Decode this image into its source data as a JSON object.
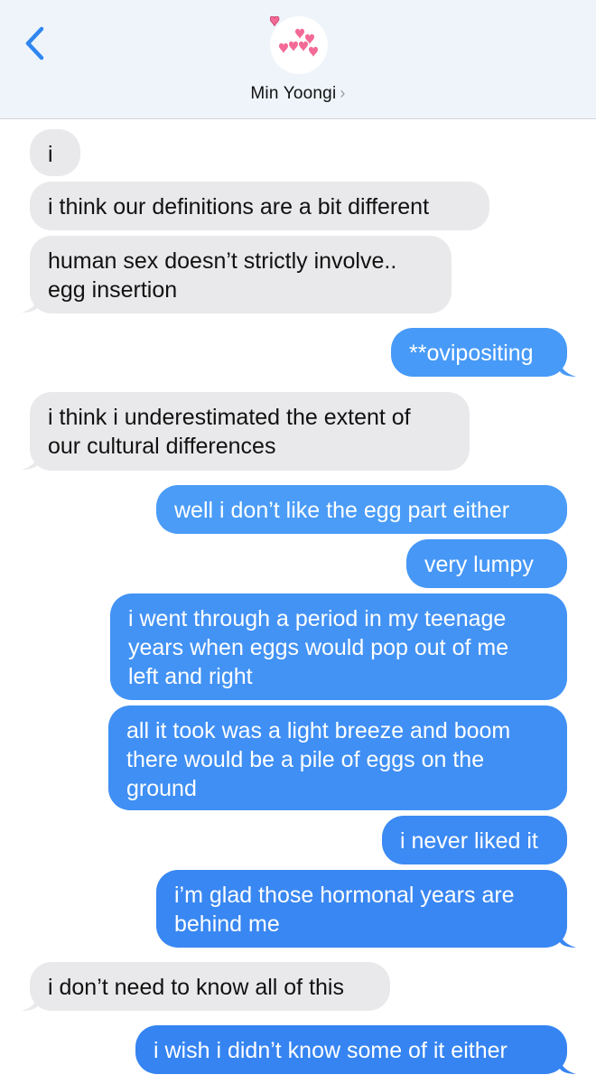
{
  "header": {
    "contact_name": "Min Yoongi",
    "chevron": "›",
    "back_icon": "chevron-left-icon",
    "avatar_icon": "hearts-avatar-icon"
  },
  "colors": {
    "header_bg": "#eef4fa",
    "received_bubble": "#e9e9eb",
    "sent_bubble": "#3e8ef5",
    "accent": "#2f86f0"
  },
  "messages": [
    {
      "from": "received",
      "text": "i"
    },
    {
      "from": "received",
      "text": "i think our definitions are a bit different"
    },
    {
      "from": "received",
      "text": "human sex doesn’t strictly involve..\negg insertion"
    },
    {
      "from": "sent",
      "text": "**ovipositing"
    },
    {
      "from": "received",
      "text": "i think i underestimated the extent of\nour cultural differences"
    },
    {
      "from": "sent",
      "text": "well i don’t like the egg part either"
    },
    {
      "from": "sent",
      "text": "very lumpy"
    },
    {
      "from": "sent",
      "text": "i went through a period in my teenage\nyears when eggs would pop out of me\nleft and right"
    },
    {
      "from": "sent",
      "text": "all it took was a light breeze and boom\nthere would be a pile of eggs on the\nground"
    },
    {
      "from": "sent",
      "text": "i never liked it"
    },
    {
      "from": "sent",
      "text": "i’m glad those hormonal years are\nbehind me"
    },
    {
      "from": "received",
      "text": "i don’t need to know all of this"
    },
    {
      "from": "sent",
      "text": "i wish i didn’t know some of it either"
    }
  ]
}
